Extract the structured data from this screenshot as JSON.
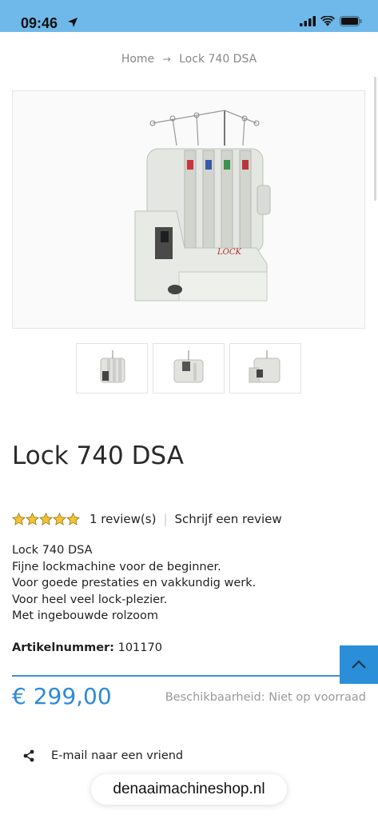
{
  "status_bar": {
    "time": "09:46"
  },
  "breadcrumb": {
    "home": "Home",
    "current": "Lock 740 DSA"
  },
  "product": {
    "title": "Lock 740 DSA",
    "rating": 5,
    "reviews_label": "1 review(s)",
    "write_review_label": "Schrijf een review",
    "description": [
      "Lock 740 DSA",
      "Fijne lockmachine voor de beginner.",
      "Voor goede prestaties en vakkundig werk.",
      "Voor heel veel lock-plezier.",
      "Met ingebouwde rolzoom"
    ],
    "sku_label": "Artikelnummer:",
    "sku_value": "101170",
    "price": "€ 299,00",
    "availability": "Beschikbaarheid: Niet op voorraad",
    "machine_brand": "LOCK"
  },
  "share": {
    "label": "E-mail naar een vriend"
  },
  "browser": {
    "url": "denaaimachineshop.nl"
  },
  "colors": {
    "accent": "#2e8ad8",
    "status_bar": "#6fb8ea",
    "star": "#f2c230"
  }
}
